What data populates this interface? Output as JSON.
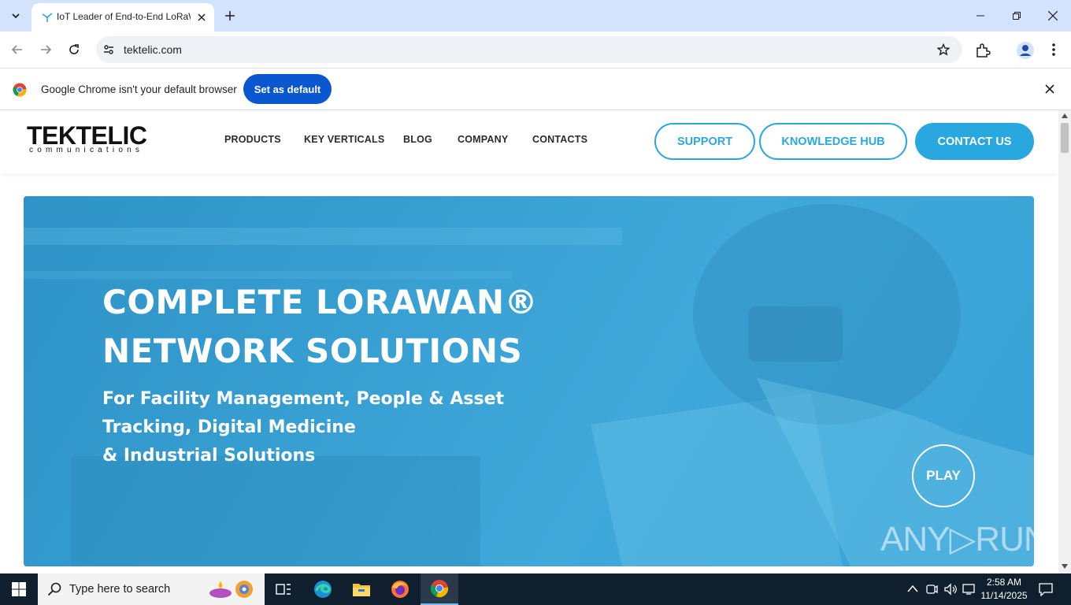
{
  "browser": {
    "tab_title": "IoT Leader of End-to-End LoRaWAN",
    "url": "tektelic.com",
    "infobar_text": "Google Chrome isn't your default browser",
    "set_default_label": "Set as default"
  },
  "site": {
    "logo": "TEKTELIC",
    "logo_sub": "communications",
    "nav": [
      "PRODUCTS",
      "KEY VERTICALS",
      "BLOG",
      "COMPANY",
      "CONTACTS"
    ],
    "support_label": "SUPPORT",
    "knowledge_label": "KNOWLEDGE HUB",
    "contact_label": "CONTACT US"
  },
  "hero": {
    "title_line1": "COMPLETE LORAWAN®",
    "title_line2": "NETWORK SOLUTIONS",
    "sub_line1": "For Facility Management, People & Asset",
    "sub_line2": "Tracking, Digital Medicine",
    "sub_line3": "& Industrial Solutions",
    "play_label": "PLAY",
    "watermark": "ANY▷RUN"
  },
  "taskbar": {
    "search_placeholder": "Type here to search",
    "time": "2:58 AM",
    "date": "11/14/2025"
  },
  "colors": {
    "brand": "#29a8df",
    "chrome_blue": "#0b57d0",
    "tabbar": "#d3e3fd"
  }
}
